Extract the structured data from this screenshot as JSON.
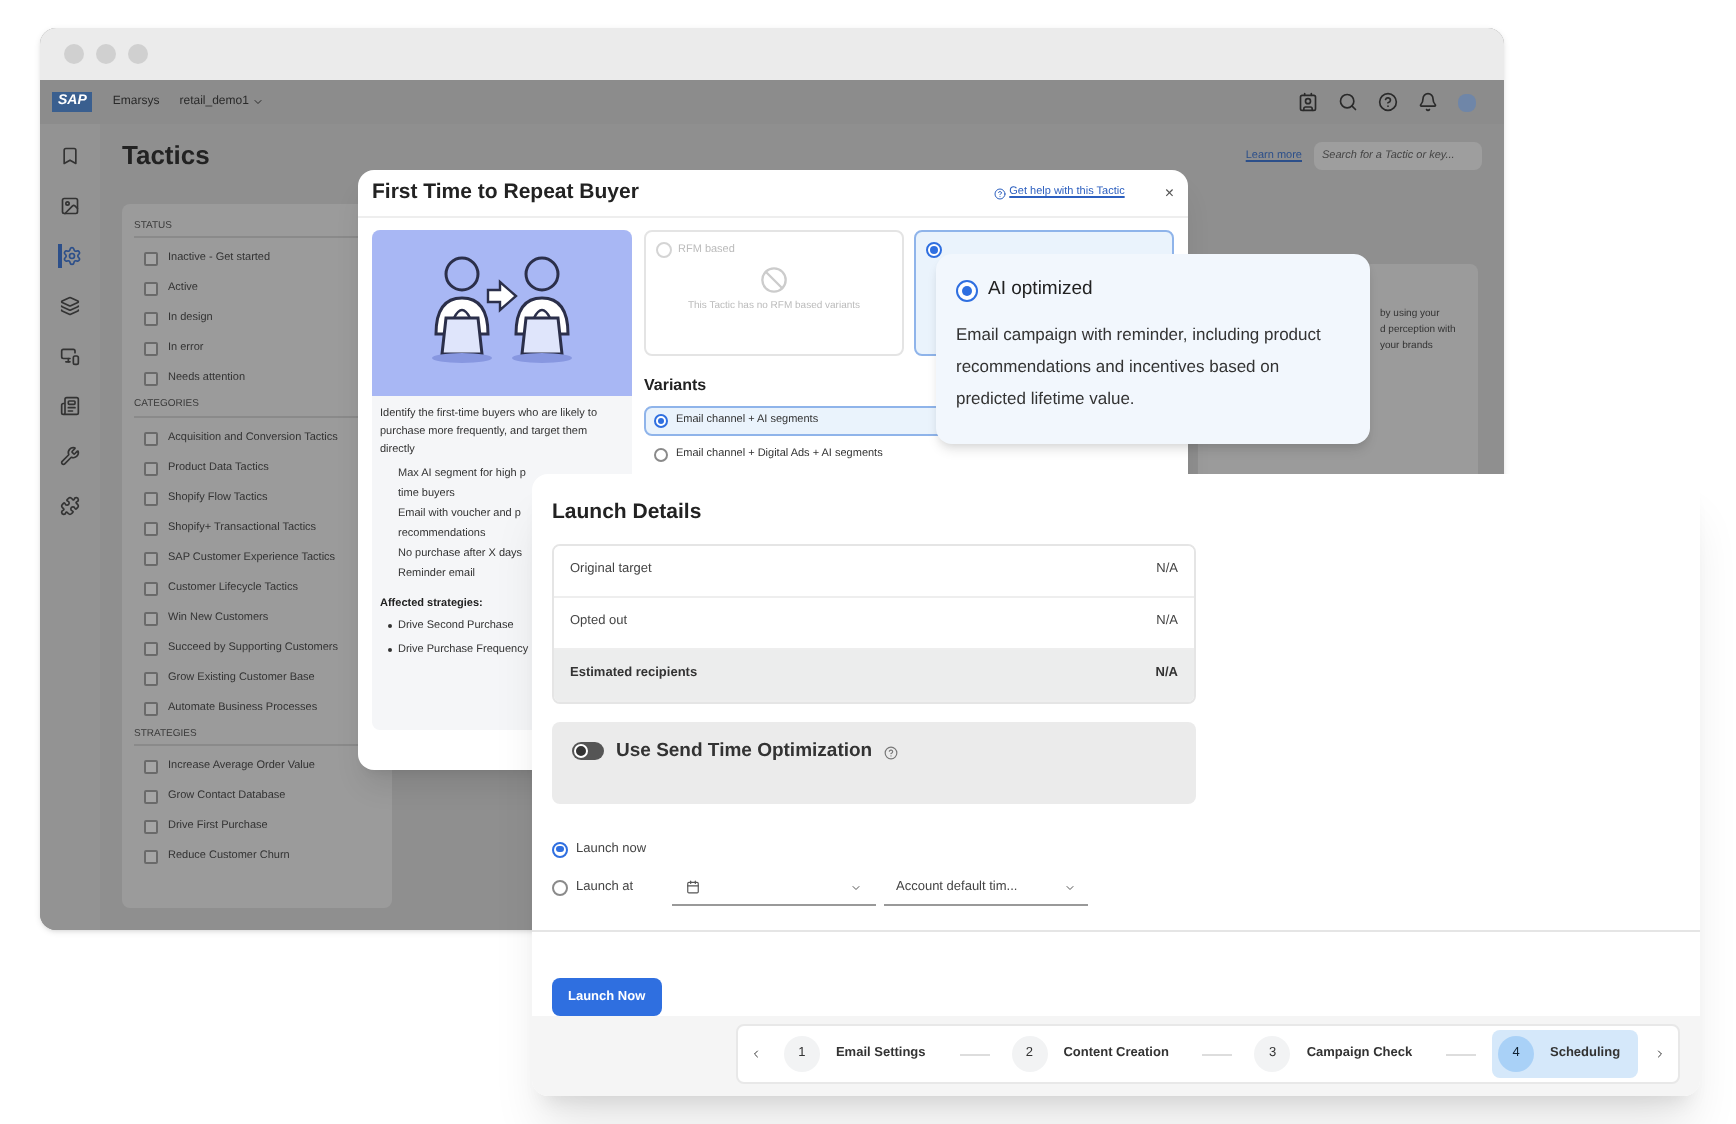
{
  "app": {
    "logo": "SAP",
    "brand": "Emarsys",
    "account": "retail_demo1",
    "page_title": "Tactics",
    "learn_more": "Learn more",
    "search": {
      "placeholder": "Search for a Tactic or key..."
    },
    "sidebar": [
      {
        "selected": false
      },
      {
        "selected": false
      },
      {
        "selected": true
      },
      {
        "selected": false
      },
      {
        "selected": false
      },
      {
        "selected": false
      },
      {
        "selected": false
      },
      {
        "selected": false
      }
    ],
    "filters": [
      {
        "title": "STATUS",
        "items": [
          {
            "label": "Inactive - Get started",
            "checked": false
          },
          {
            "label": "Active",
            "checked": false
          },
          {
            "label": "In design",
            "checked": false
          },
          {
            "label": "In error",
            "checked": false
          },
          {
            "label": "Needs attention",
            "checked": false
          }
        ]
      },
      {
        "title": "CATEGORIES",
        "items": [
          {
            "label": "Acquisition and Conversion Tactics",
            "checked": false
          },
          {
            "label": "Product Data Tactics",
            "checked": false
          },
          {
            "label": "Shopify Flow Tactics",
            "checked": false
          },
          {
            "label": "Shopify+ Transactional Tactics",
            "checked": false
          },
          {
            "label": "SAP Customer Experience Tactics",
            "checked": false
          },
          {
            "label": "Customer Lifecycle Tactics",
            "checked": false
          },
          {
            "label": "Win New Customers",
            "checked": false
          },
          {
            "label": "Succeed by Supporting Customers",
            "checked": false
          },
          {
            "label": "Grow Existing Customer Base",
            "checked": false
          },
          {
            "label": "Automate Business Processes",
            "checked": false
          }
        ]
      },
      {
        "title": "STRATEGIES",
        "items": [
          {
            "label": "Increase Average Order Value",
            "checked": false
          },
          {
            "label": "Grow Contact Database",
            "checked": false
          },
          {
            "label": "Drive First Purchase",
            "checked": false
          },
          {
            "label": "Reduce Customer Churn",
            "checked": false
          }
        ]
      }
    ],
    "card_lines": [
      "by using your",
      "d perception with",
      "your brands"
    ]
  },
  "modal": {
    "title": "First Time to Repeat Buyer",
    "help_link": "Get help with this Tactic",
    "close": "×",
    "description": "Identify the first-time buyers who are likely to purchase more frequently, and target them directly",
    "steps": [
      "Max AI segment for high p",
      "time buyers",
      "Email with voucher and p",
      "recommendations",
      "No purchase after X days",
      "Reminder email"
    ],
    "affected_title": "Affected strategies:",
    "strategies": [
      "Drive Second Purchase",
      "Drive Purchase Frequency"
    ],
    "options": [
      {
        "label": "RFM based",
        "note": "This Tactic has no RFM based variants",
        "selected": false,
        "disabled": true
      },
      {
        "selected": true,
        "disabled": false
      }
    ],
    "variants_title": "Variants",
    "variants": [
      {
        "label": "Email channel + AI segments",
        "selected": true
      },
      {
        "label": "Email channel + Digital Ads + AI segments",
        "selected": false
      }
    ]
  },
  "tooltip": {
    "label": "AI optimized",
    "selected": true,
    "text": "Email campaign with reminder, including product recommendations and incentives based on predicted lifetime value."
  },
  "launch": {
    "title": "Launch Details",
    "rows": [
      {
        "label": "Original target",
        "value": "N/A",
        "kind": "normal"
      },
      {
        "label": "Opted out",
        "value": "N/A",
        "kind": "normal"
      },
      {
        "label": "Estimated recipients",
        "value": "N/A",
        "kind": "total"
      }
    ],
    "sto": {
      "label": "Use Send Time Optimization",
      "on": false
    },
    "schedule": [
      {
        "label": "Launch now",
        "selected": true
      },
      {
        "label": "Launch at",
        "selected": false
      }
    ],
    "timezone": "Account default tim...",
    "button": "Launch Now"
  },
  "stepper": [
    {
      "number": "1",
      "label": "Email Settings",
      "selected": false
    },
    {
      "number": "2",
      "label": "Content Creation",
      "selected": false
    },
    {
      "number": "3",
      "label": "Campaign Check",
      "selected": false
    },
    {
      "number": "4",
      "label": "Scheduling",
      "selected": true
    }
  ]
}
